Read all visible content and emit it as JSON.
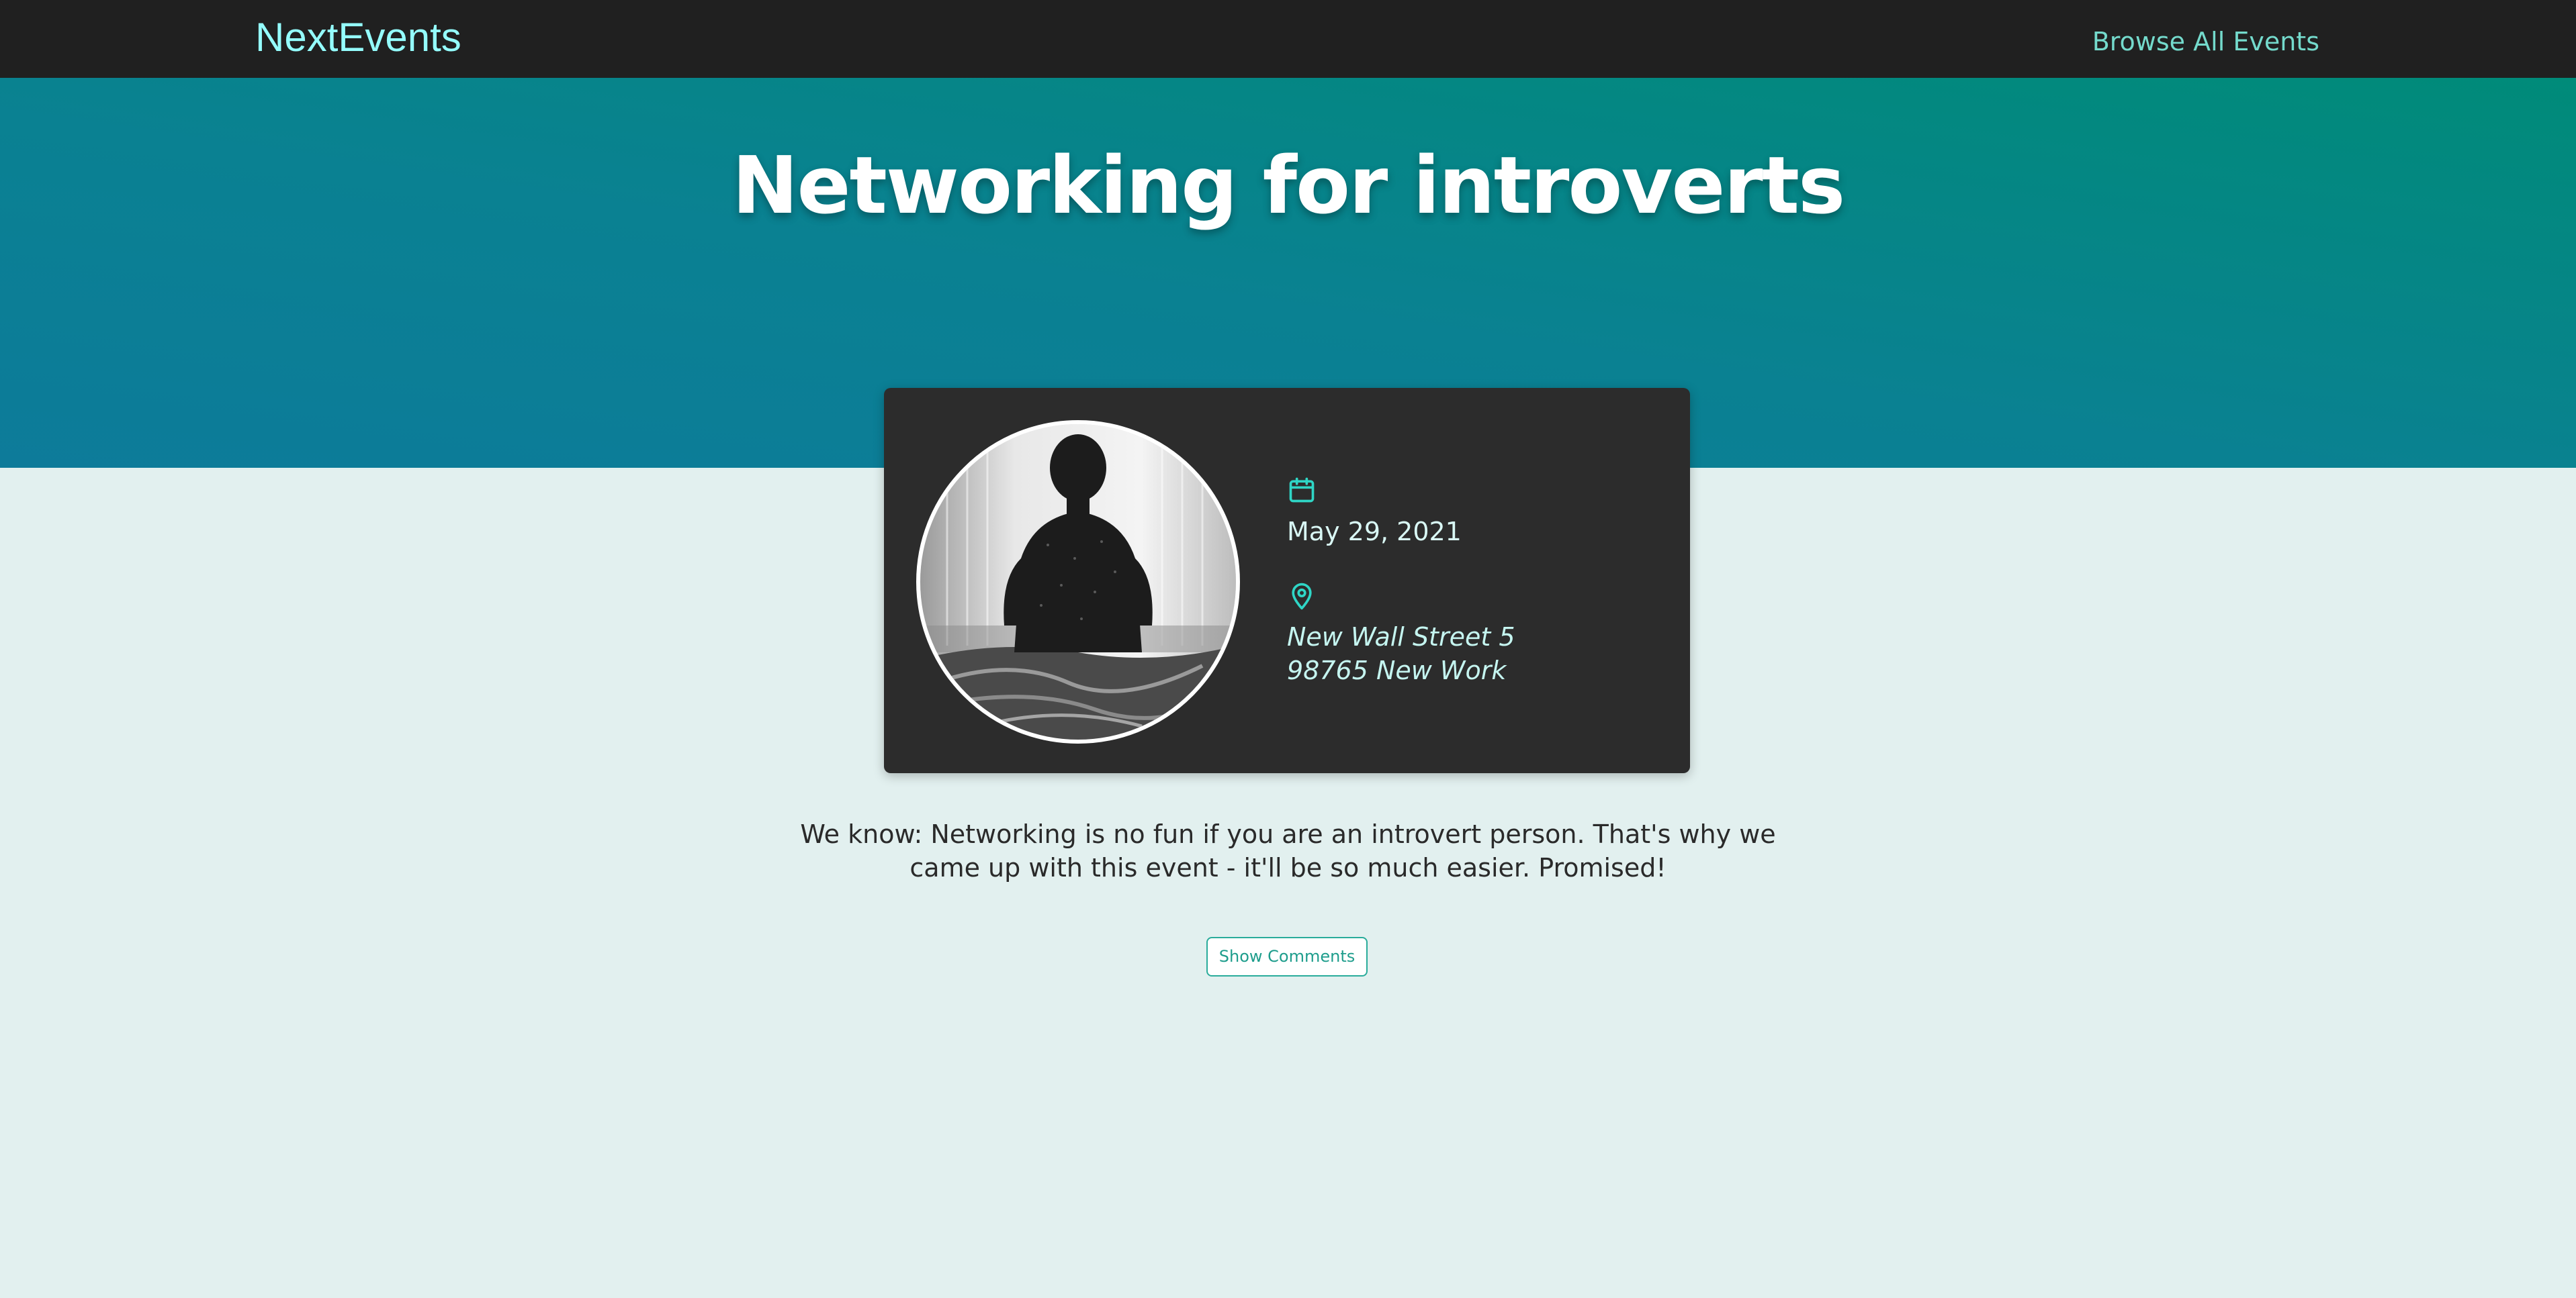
{
  "header": {
    "logo": "NextEvents",
    "nav_link": "Browse All Events"
  },
  "event": {
    "title": "Networking for introverts",
    "date": "May 29, 2021",
    "address_line1": "New Wall Street 5",
    "address_line2": "98765 New Work",
    "description": "We know: Networking is no fun if you are an introvert person. That's why we came up with this event - it'll be so much easier. Promised!",
    "comments_button": "Show Comments"
  },
  "icons": {
    "date": "calendar-icon",
    "address": "location-pin-icon"
  },
  "colors": {
    "header_bg": "#202020",
    "logo": "#94fdfd",
    "nav_link": "#74dacc",
    "hero_gradient_start": "#008b79",
    "hero_gradient_end": "#0d7b9a",
    "page_bg": "#e2f0ef",
    "card_bg": "#2c2c2c",
    "icon_accent": "#2fd6c6",
    "button_border": "#2aac9b"
  }
}
